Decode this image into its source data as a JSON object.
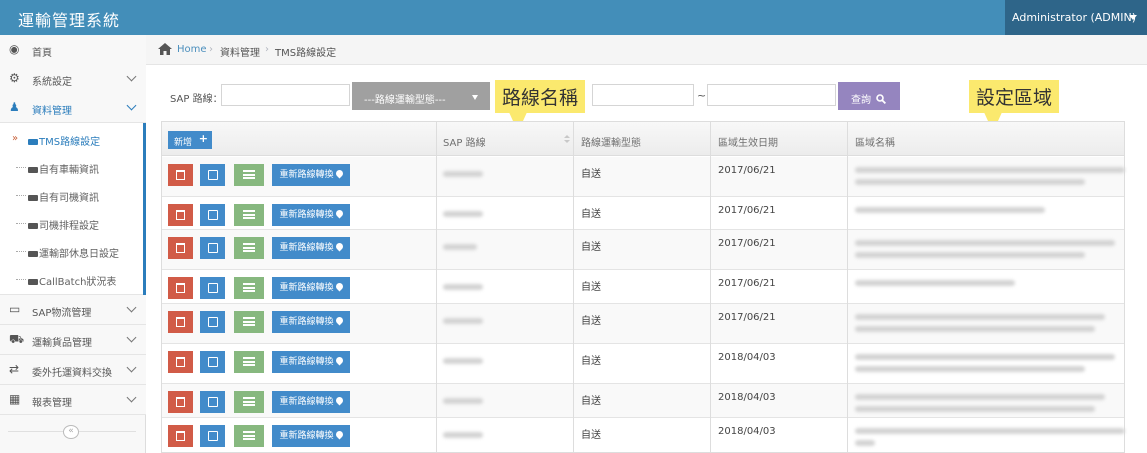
{
  "app": {
    "title": "運輸管理系統",
    "user": "Administrator (ADMIN)"
  },
  "sidebar": {
    "items": [
      {
        "label": "首頁",
        "icon": "dashboard-icon"
      },
      {
        "label": "系統設定",
        "icon": "cogs-icon"
      },
      {
        "label": "資料管理",
        "icon": "users-icon"
      },
      {
        "label": "SAP物流管理",
        "icon": "desktop-icon"
      },
      {
        "label": "運輸貨品管理",
        "icon": "truck-icon"
      },
      {
        "label": "委外托運資料交換",
        "icon": "exchange-icon"
      },
      {
        "label": "報表管理",
        "icon": "grid-icon"
      }
    ],
    "submenu": [
      {
        "label": "TMS路線設定"
      },
      {
        "label": "自有車輛資訊"
      },
      {
        "label": "自有司機資訊"
      },
      {
        "label": "司機排程設定"
      },
      {
        "label": "運輸部休息日設定"
      },
      {
        "label": "CallBatch狀況表"
      }
    ],
    "collapse": "«"
  },
  "breadcrumb": {
    "home": "Home",
    "level1": "資料管理",
    "level2": "TMS路線設定"
  },
  "filter": {
    "sap_label": "SAP 路線：",
    "type_select": "---路線運輸型態---",
    "tilde": "~",
    "query": "查詢"
  },
  "callouts": {
    "route_name": "路線名稱",
    "area": "設定區域"
  },
  "table": {
    "add": "新增",
    "headers": {
      "sap": "SAP 路線",
      "type": "路線運輸型態",
      "date": "區域生效日期",
      "area": "區域名稱"
    },
    "reroute": "重新路線轉換",
    "rows": [
      {
        "type": "自送",
        "date": "2017/06/21"
      },
      {
        "type": "自送",
        "date": "2017/06/21"
      },
      {
        "type": "自送",
        "date": "2017/06/21"
      },
      {
        "type": "自送",
        "date": "2017/06/21"
      },
      {
        "type": "自送",
        "date": "2017/06/21"
      },
      {
        "type": "自送",
        "date": "2018/04/03"
      },
      {
        "type": "自送",
        "date": "2018/04/03"
      },
      {
        "type": "自送",
        "date": "2018/04/03"
      }
    ]
  },
  "colors": {
    "header": "#438eb9",
    "accent": "#2b7dbc",
    "danger": "#d15b47",
    "success": "#87b87f",
    "purple": "#9585bf",
    "callout": "#fbe96e"
  }
}
